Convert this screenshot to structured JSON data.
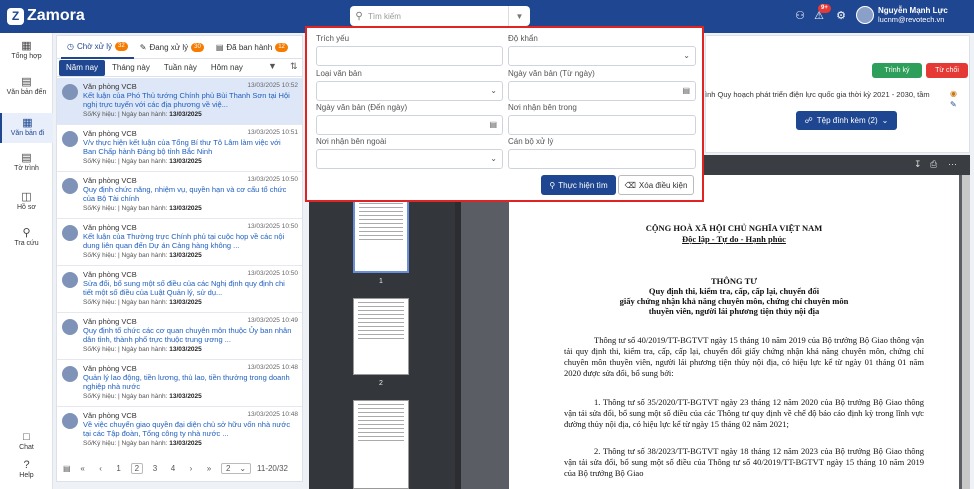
{
  "app": {
    "logo_letter": "Z",
    "name": "Zamora"
  },
  "search": {
    "placeholder": "Tìm kiếm"
  },
  "header": {
    "notif_count": "9+",
    "user_name": "Nguyễn Mạnh Lực",
    "user_email": "lucnm@revotech.vn"
  },
  "sidebar": {
    "items": [
      {
        "label": "Tổng hợp"
      },
      {
        "label": "Văn bản đến"
      },
      {
        "label": "Văn bản đi"
      },
      {
        "label": "Tờ trình"
      },
      {
        "label": "Hồ sơ"
      },
      {
        "label": "Tra cứu"
      },
      {
        "label": "Chat"
      },
      {
        "label": "Help"
      }
    ]
  },
  "tabs": [
    {
      "label": "Chờ xử lý",
      "count": "32"
    },
    {
      "label": "Đang xử lý",
      "count": "30"
    },
    {
      "label": "Đã ban hành",
      "count": "12"
    }
  ],
  "subtabs": [
    "Năm nay",
    "Tháng này",
    "Tuần này",
    "Hôm nay"
  ],
  "items": [
    {
      "org": "Văn phòng VCB",
      "time": "13/03/2025 10:52",
      "title": "Kết luận của Phó Thủ tướng Chính phủ Bùi Thanh Sơn tại Hội nghị trực tuyến với các địa phương về việ...",
      "meta_label": "Số/Ký hiệu: | Ngày ban hành: ",
      "date": "13/03/2025"
    },
    {
      "org": "Văn phòng VCB",
      "time": "13/03/2025 10:51",
      "title": "V/v thực hiện kết luận của Tổng Bí thư Tô Lâm làm việc với Ban Chấp hành Đảng bộ tỉnh Bắc Ninh",
      "meta_label": "Số/Ký hiệu: | Ngày ban hành: ",
      "date": "13/03/2025"
    },
    {
      "org": "Văn phòng VCB",
      "time": "13/03/2025 10:50",
      "title": "Quy định chức năng, nhiệm vụ, quyền hạn và cơ cấu tổ chức của Bộ Tài chính",
      "meta_label": "Số/Ký hiệu: | Ngày ban hành: ",
      "date": "13/03/2025"
    },
    {
      "org": "Văn phòng VCB",
      "time": "13/03/2025 10:50",
      "title": "Kết luận của Thường trực Chính phủ tại cuộc họp về các nội dung liên quan đến Dự án Cảng hàng không ...",
      "meta_label": "Số/Ký hiệu: | Ngày ban hành: ",
      "date": "13/03/2025"
    },
    {
      "org": "Văn phòng VCB",
      "time": "13/03/2025 10:50",
      "title": "Sửa đổi, bổ sung một số điều của các Nghị định quy định chi tiết một số điều của Luật Quản lý, sử dụ...",
      "meta_label": "Số/Ký hiệu: | Ngày ban hành: ",
      "date": "13/03/2025"
    },
    {
      "org": "Văn phòng VCB",
      "time": "13/03/2025 10:49",
      "title": "Quy định tổ chức các cơ quan chuyên môn thuộc Ủy ban nhân dân tỉnh, thành phố trực thuộc trung ương ...",
      "meta_label": "Số/Ký hiệu: | Ngày ban hành: ",
      "date": "13/03/2025"
    },
    {
      "org": "Văn phòng VCB",
      "time": "13/03/2025 10:48",
      "title": "Quản lý lao động, tiền lương, thù lao, tiền thưởng trong doanh nghiệp nhà nước",
      "meta_label": "Số/Ký hiệu: | Ngày ban hành: ",
      "date": "13/03/2025"
    },
    {
      "org": "Văn phòng VCB",
      "time": "13/03/2025 10:48",
      "title": "Về việc chuyển giao quyền đại diện chủ sở hữu vốn nhà nước tại các Tập đoàn, Tổng công ty nhà nước ...",
      "meta_label": "Số/Ký hiệu: | Ngày ban hành: ",
      "date": "13/03/2025"
    }
  ],
  "pager": {
    "p1": "1",
    "p2": "2",
    "p3": "3",
    "p4": "4",
    "per_page": "2",
    "range": "11-20/32"
  },
  "actions": {
    "approve": "Trình ký",
    "reject": "Từ chối",
    "attach": "Tệp đính kèm (2)"
  },
  "doc_title_partial": "ình Quy hoạch phát triển điện lực quốc gia thời kỳ 2021 - 2030, tầm",
  "thumb_labels": [
    "1",
    "2"
  ],
  "filter": {
    "trich_yeu": "Trích yếu",
    "do_khan": "Độ khẩn",
    "loai_van_ban": "Loại văn bản",
    "ngay_tu": "Ngày văn bản (Từ ngày)",
    "ngay_den": "Ngày văn bản (Đến ngày)",
    "noi_nhan_trong": "Nơi nhận bên trong",
    "noi_nhan_ngoai": "Nơi nhận bên ngoài",
    "can_bo": "Cán bộ xử lý",
    "search_btn": "Thực hiện tìm",
    "clear_btn": "Xóa điều kiện"
  },
  "page": {
    "nation": "CỘNG HOÀ XÃ HỘI CHỦ NGHĨA VIỆT NAM",
    "motto": "Độc lập - Tự do - Hạnh phúc",
    "doc_type": "THÔNG TƯ",
    "subject1": "Quy định thi, kiểm tra, cấp, cấp lại, chuyển đổi",
    "subject2": "giấy chứng nhận khả năng chuyên môn, chứng chỉ chuyên môn",
    "subject3": "thuyền viên, người lái phương tiện thủy nội địa",
    "para1": "Thông tư số 40/2019/TT-BGTVT ngày 15 tháng 10 năm 2019 của Bộ trưởng Bộ Giao thông vận tải quy định thi, kiểm tra, cấp, cấp lại, chuyển đổi giấy chứng nhận khả năng chuyên môn, chứng chỉ chuyên môn thuyền viên, người lái phương tiện thủy nội địa, có hiệu lực kể từ ngày 01 tháng 01 năm 2020 được sửa đổi, bổ sung bởi:",
    "para2": "1. Thông tư số 35/2020/TT-BGTVT ngày 23 tháng 12 năm 2020 của Bộ trưởng Bộ Giao thông vận tải sửa đổi, bổ sung một số điều của các Thông tư quy định về chế độ báo cáo định kỳ trong lĩnh vực đường thủy nội địa, có hiệu lực kể từ ngày 15 tháng 02 năm 2021;",
    "para3": "2. Thông tư số 38/2023/TT-BGTVT ngày 18 tháng 12 năm 2023 của Bộ trưởng Bộ Giao thông vận tải sửa đổi, bổ sung một số điều của Thông tư số 40/2019/TT-BGTVT ngày 15 tháng 10 năm 2019 của Bộ trưởng Bộ Giao"
  }
}
